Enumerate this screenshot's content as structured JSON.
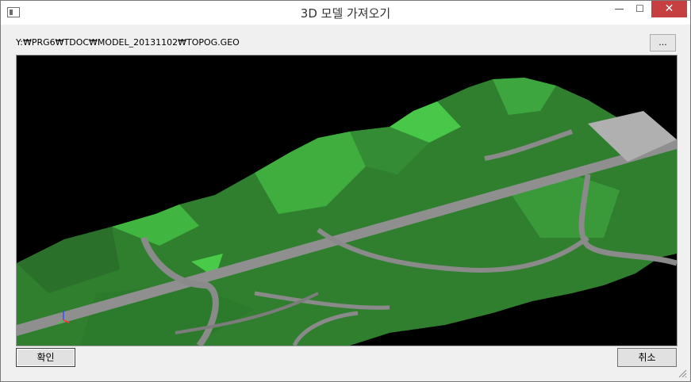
{
  "window": {
    "title": "3D 모델 가져오기"
  },
  "path_label": "Y:₩PRG6₩TDOC₩MODEL_20131102₩TOPOG.GEO",
  "browse_label": "...",
  "buttons": {
    "ok": "확인",
    "cancel": "취소"
  },
  "colors": {
    "terrain_dark": "#2f7f2f",
    "terrain_light": "#46c246",
    "road": "#8f8f8f",
    "background": "#000000"
  }
}
